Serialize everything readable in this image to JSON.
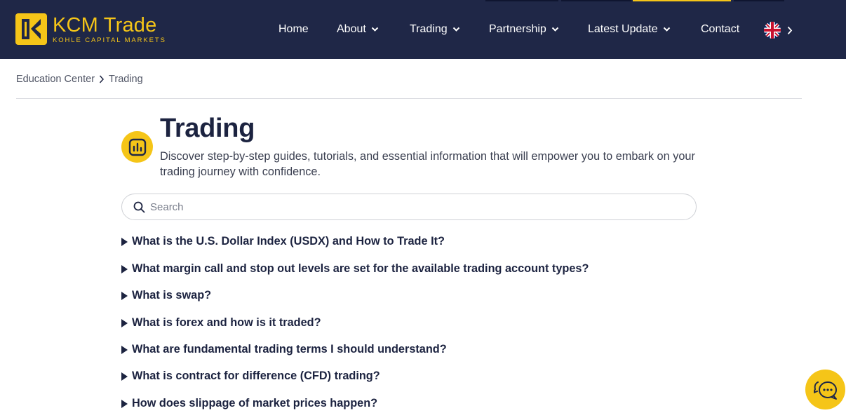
{
  "brand": {
    "name": "KCM Trade",
    "subtitle": "KOHLE CAPITAL MARKETS",
    "accent_color": "#f5c518",
    "header_color": "#1f2747"
  },
  "nav": {
    "items": [
      {
        "label": "Home",
        "has_dropdown": false
      },
      {
        "label": "About",
        "has_dropdown": true
      },
      {
        "label": "Trading",
        "has_dropdown": true
      },
      {
        "label": "Partnership",
        "has_dropdown": true
      },
      {
        "label": "Latest Update",
        "has_dropdown": true
      },
      {
        "label": "Contact",
        "has_dropdown": false
      }
    ],
    "language_icon": "uk-flag-icon"
  },
  "breadcrumb": {
    "root": "Education Center",
    "current": "Trading"
  },
  "category": {
    "icon": "bar-chart-icon",
    "title": "Trading",
    "description": "Discover step-by-step guides, tutorials, and essential information that will empower you to embark on your trading journey with confidence."
  },
  "search": {
    "placeholder": "Search",
    "value": ""
  },
  "faqs": [
    "What is the U.S. Dollar Index (USDX) and How to Trade It?",
    "What margin call and stop out levels are set for the available trading account types?",
    "What is swap?",
    "What is forex and how is it traded?",
    "What are fundamental trading terms I should understand?",
    "What is contract for difference (CFD) trading?",
    "How does slippage of market prices happen?"
  ],
  "chat": {
    "icon": "chat-bubbles-icon"
  }
}
